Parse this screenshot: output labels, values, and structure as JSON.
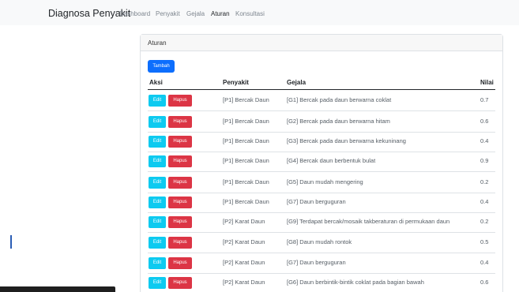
{
  "navbar": {
    "brand": "Diagnosa Penyakit",
    "links": [
      {
        "label": "Dashboard",
        "active": false
      },
      {
        "label": "Penyakit",
        "active": false
      },
      {
        "label": "Gejala",
        "active": false
      },
      {
        "label": "Aturan",
        "active": true
      },
      {
        "label": "Konsultasi",
        "active": false
      }
    ]
  },
  "card": {
    "title": "Aturan"
  },
  "toolbar": {
    "add_label": "Tambah"
  },
  "table": {
    "headers": [
      "Aksi",
      "Penyakit",
      "Gejala",
      "Nilai"
    ],
    "edit_label": "Edit",
    "delete_label": "Hapus",
    "rows": [
      {
        "penyakit": "[P1] Bercak Daun",
        "gejala": "[G1] Bercak pada daun berwarna coklat",
        "nilai": "0.7"
      },
      {
        "penyakit": "[P1] Bercak Daun",
        "gejala": "[G2] Bercak pada daun berwarna hitam",
        "nilai": "0.6"
      },
      {
        "penyakit": "[P1] Bercak Daun",
        "gejala": "[G3] Bercak pada daun berwarna kekuninang",
        "nilai": "0.4"
      },
      {
        "penyakit": "[P1] Bercak Daun",
        "gejala": "[G4] Bercak daun berbentuk bulat",
        "nilai": "0.9"
      },
      {
        "penyakit": "[P1] Bercak Daun",
        "gejala": "[G5] Daun mudah mengering",
        "nilai": "0.2"
      },
      {
        "penyakit": "[P1] Bercak Daun",
        "gejala": "[G7] Daun berguguran",
        "nilai": "0.4"
      },
      {
        "penyakit": "[P2] Karat Daun",
        "gejala": "[G9] Terdapat bercak/mosaik takberaturan di permukaan daun",
        "nilai": "0.2"
      },
      {
        "penyakit": "[P2] Karat Daun",
        "gejala": "[G8] Daun mudah rontok",
        "nilai": "0.5"
      },
      {
        "penyakit": "[P2] Karat Daun",
        "gejala": "[G7] Daun berguguran",
        "nilai": "0.4"
      },
      {
        "penyakit": "[P2] Karat Daun",
        "gejala": "[G6] Daun berbintik-bintik coklat pada bagian bawah",
        "nilai": "0.6"
      }
    ]
  },
  "colors": {
    "primary": "#0d6efd",
    "edit": "#0dcaf0",
    "delete": "#dc3545"
  }
}
